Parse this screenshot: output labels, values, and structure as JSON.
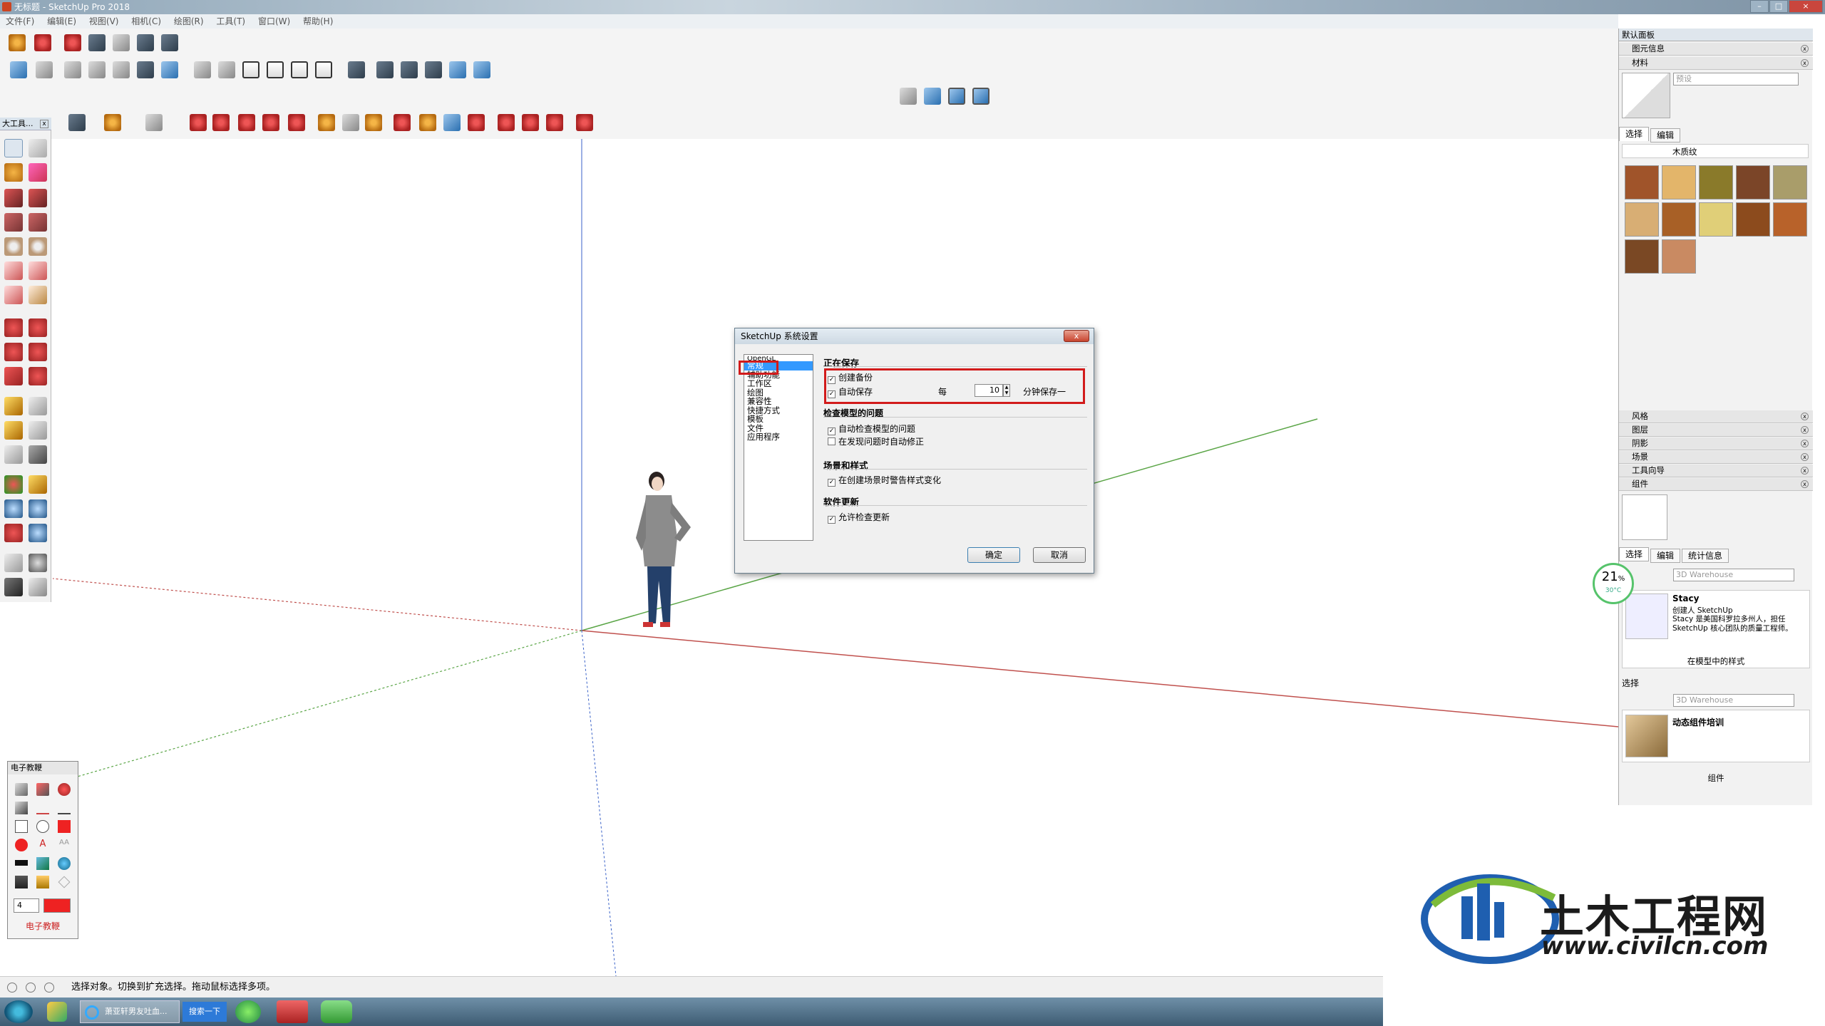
{
  "window": {
    "title": "无标题 - SketchUp Pro 2018"
  },
  "menu": [
    "文件(F)",
    "编辑(E)",
    "视图(V)",
    "相机(C)",
    "绘图(R)",
    "工具(T)",
    "窗口(W)",
    "帮助(H)"
  ],
  "left_toolbar": {
    "title": "大工具..."
  },
  "dialog": {
    "title": "SketchUp 系统设置",
    "close": "x",
    "nav_items": [
      "OpenGL",
      "常规",
      "辅助功能",
      "工作区",
      "绘图",
      "兼容性",
      "快捷方式",
      "模板",
      "文件",
      "应用程序"
    ],
    "selected_nav": "常规",
    "sections": {
      "saving": "正在保存",
      "check_model": "检查模型的问题",
      "scenes_styles": "场景和样式",
      "software_update": "软件更新"
    },
    "options": {
      "create_backup": "创建备份",
      "auto_save": "自动保存",
      "every": "每",
      "minutes_value": "10",
      "minutes_suffix": "分钟保存一",
      "auto_check": "自动检查模型的问题",
      "auto_fix": "在发现问题时自动修正",
      "warn_style": "在创建场景时警告样式变化",
      "allow_update": "允许检查更新"
    },
    "ok": "确定",
    "cancel": "取消"
  },
  "right_panel": {
    "title": "默认面板",
    "entity_info": "图元信息",
    "materials": "材料",
    "preset_placeholder": "预设",
    "tab_select": "选择",
    "tab_edit": "编辑",
    "material_library": "木质纹",
    "collapsed": [
      "风格",
      "图层",
      "阴影",
      "场景",
      "工具向导"
    ],
    "components": "组件",
    "comp_tabs": [
      "选择",
      "编辑",
      "统计信息"
    ],
    "warehouse_placeholder": "3D Warehouse",
    "component_name": "Stacy",
    "component_desc1": "创建人 SketchUp",
    "component_desc2": "Stacy 是美国科罗拉多州人，担任 SketchUp 核心团队的质量工程师。",
    "in_model": "在模型中的样式",
    "select2": "选择",
    "dynamic_training": "动态组件培训",
    "components_footer": "组件"
  },
  "gauge": {
    "value": "21",
    "unit": "%",
    "temp": "30°C"
  },
  "tutorial": {
    "title": "电子教鞭",
    "size": "4",
    "footer": "电子教鞭"
  },
  "status": {
    "text": "选择对象。切换到扩充选择。拖动鼠标选择多项。"
  },
  "taskbar": {
    "ie_item": "萧亚轩男友吐血...",
    "search_button": "搜索一下"
  },
  "watermark": {
    "brand": "土木工程网",
    "url": "www.civilcn.com"
  },
  "colors": {
    "accent_red": "#d21b1b",
    "selection_blue": "#3399ff",
    "axis_red": "#c0504d",
    "axis_green": "#5aa546"
  }
}
